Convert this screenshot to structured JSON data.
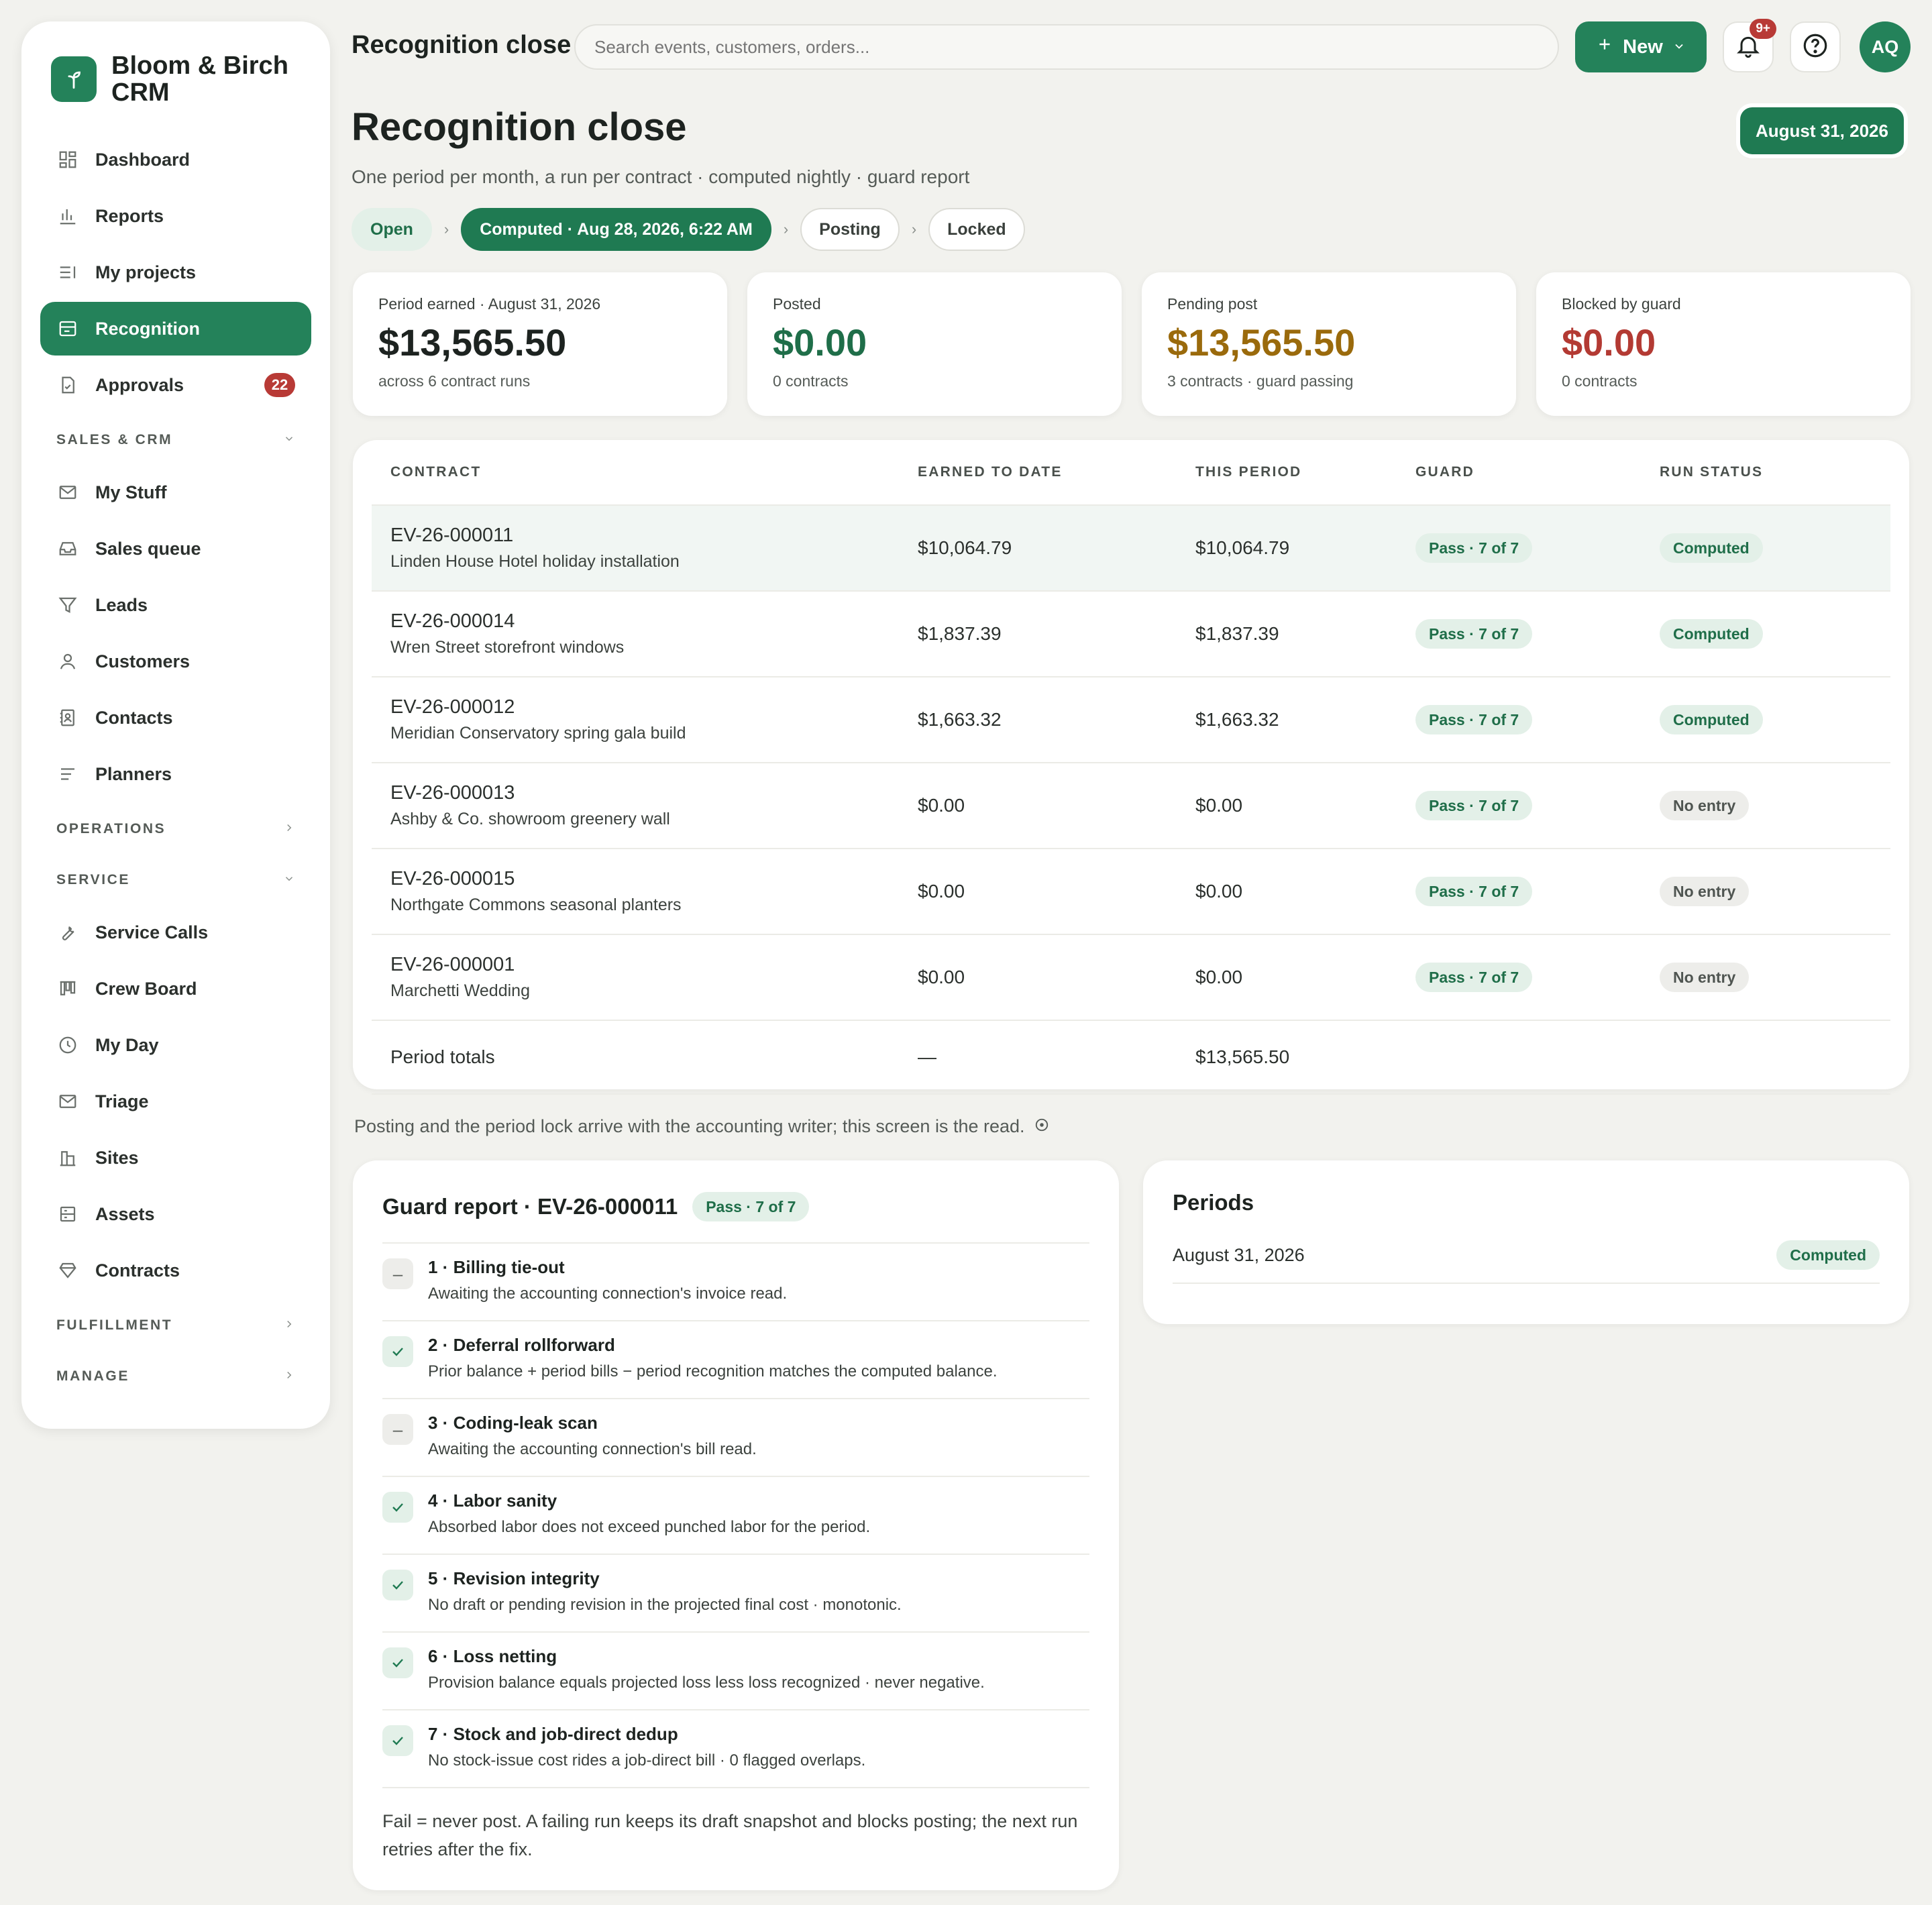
{
  "brand": {
    "name": "Bloom & Birch CRM"
  },
  "sidebar": {
    "items_top": [
      {
        "label": "Dashboard",
        "icon": "dashboard-icon"
      },
      {
        "label": "Reports",
        "icon": "bar-chart-icon"
      },
      {
        "label": "My projects",
        "icon": "list-icon"
      },
      {
        "label": "Recognition",
        "icon": "ledger-icon",
        "active": true
      },
      {
        "label": "Approvals",
        "icon": "clipboard-check-icon",
        "badge": "22"
      }
    ],
    "sections": [
      {
        "label": "SALES & CRM",
        "expanded": true
      },
      {
        "label": "OPERATIONS",
        "expanded": false
      },
      {
        "label": "SERVICE",
        "expanded": true
      },
      {
        "label": "FULFILLMENT",
        "expanded": false
      },
      {
        "label": "MANAGE",
        "expanded": false
      }
    ],
    "items_sales": [
      "My Stuff",
      "Sales queue",
      "Leads",
      "Customers",
      "Contacts",
      "Planners"
    ],
    "items_service": [
      "Service Calls",
      "Crew Board",
      "My Day",
      "Triage",
      "Sites",
      "Assets",
      "Contracts"
    ]
  },
  "topbar": {
    "title": "Recognition close",
    "search_placeholder": "Search events, customers, orders...",
    "new_label": "New",
    "notif_badge": "9+",
    "avatar": "AQ"
  },
  "page": {
    "title": "Recognition close",
    "subtitle": "One period per month, a run per contract · computed nightly · guard report",
    "period_date": "August 31, 2026",
    "steps": [
      {
        "label": "Open",
        "state": "done"
      },
      {
        "label": "Computed · Aug 28, 2026, 6:22 AM",
        "state": "current"
      },
      {
        "label": "Posting",
        "state": "todo"
      },
      {
        "label": "Locked",
        "state": "todo"
      }
    ]
  },
  "kpis": [
    {
      "label": "Period earned · August 31, 2026",
      "value": "$13,565.50",
      "note": "across 6 contract runs",
      "color": "#1d2320"
    },
    {
      "label": "Posted",
      "value": "$0.00",
      "note": "0 contracts",
      "color": "#1f6e49"
    },
    {
      "label": "Pending post",
      "value": "$13,565.50",
      "note": "3 contracts · guard passing",
      "color": "#9a6a0c"
    },
    {
      "label": "Blocked by guard",
      "value": "$0.00",
      "note": "0 contracts",
      "color": "#b33a33"
    }
  ],
  "table": {
    "headers": [
      "CONTRACT",
      "EARNED TO DATE",
      "THIS PERIOD",
      "GUARD",
      "RUN STATUS"
    ],
    "rows": [
      {
        "id": "EV-26-000011",
        "desc": "Linden House Hotel holiday installation",
        "earned": "$10,064.79",
        "period": "$10,064.79",
        "guard": "Pass · 7 of 7",
        "status": "Computed",
        "status_kind": "green"
      },
      {
        "id": "EV-26-000014",
        "desc": "Wren Street storefront windows",
        "earned": "$1,837.39",
        "period": "$1,837.39",
        "guard": "Pass · 7 of 7",
        "status": "Computed",
        "status_kind": "green"
      },
      {
        "id": "EV-26-000012",
        "desc": "Meridian Conservatory spring gala build",
        "earned": "$1,663.32",
        "period": "$1,663.32",
        "guard": "Pass · 7 of 7",
        "status": "Computed",
        "status_kind": "green"
      },
      {
        "id": "EV-26-000013",
        "desc": "Ashby & Co. showroom greenery wall",
        "earned": "$0.00",
        "period": "$0.00",
        "guard": "Pass · 7 of 7",
        "status": "No entry",
        "status_kind": "grey"
      },
      {
        "id": "EV-26-000015",
        "desc": "Northgate Commons seasonal planters",
        "earned": "$0.00",
        "period": "$0.00",
        "guard": "Pass · 7 of 7",
        "status": "No entry",
        "status_kind": "grey"
      },
      {
        "id": "EV-26-000001",
        "desc": "Marchetti Wedding",
        "earned": "$0.00",
        "period": "$0.00",
        "guard": "Pass · 7 of 7",
        "status": "No entry",
        "status_kind": "grey"
      }
    ],
    "totals": {
      "label": "Period totals",
      "earned": "—",
      "period": "$13,565.50"
    }
  },
  "footnote": "Posting and the period lock arrive with the accounting writer; this screen is the read.",
  "guard": {
    "title": "Guard report · EV-26-000011",
    "badge": "Pass · 7 of 7",
    "checks": [
      {
        "title": "1 · Billing tie-out",
        "desc": "Awaiting the accounting connection's invoice read.",
        "state": "wait"
      },
      {
        "title": "2 · Deferral rollforward",
        "desc": "Prior balance + period bills − period recognition matches the computed balance.",
        "state": "pass"
      },
      {
        "title": "3 · Coding-leak scan",
        "desc": "Awaiting the accounting connection's bill read.",
        "state": "wait"
      },
      {
        "title": "4 · Labor sanity",
        "desc": "Absorbed labor does not exceed punched labor for the period.",
        "state": "pass"
      },
      {
        "title": "5 · Revision integrity",
        "desc": "No draft or pending revision in the projected final cost · monotonic.",
        "state": "pass"
      },
      {
        "title": "6 · Loss netting",
        "desc": "Provision balance equals projected loss less loss recognized · never negative.",
        "state": "pass"
      },
      {
        "title": "7 · Stock and job-direct dedup",
        "desc": "No stock-issue cost rides a job-direct bill · 0 flagged overlaps.",
        "state": "pass"
      }
    ],
    "footer": "Fail = never post. A failing run keeps its draft snapshot and blocks posting; the next run retries after the fix."
  },
  "periods": {
    "title": "Periods",
    "rows": [
      {
        "date": "August 31, 2026",
        "status": "Computed"
      }
    ]
  }
}
